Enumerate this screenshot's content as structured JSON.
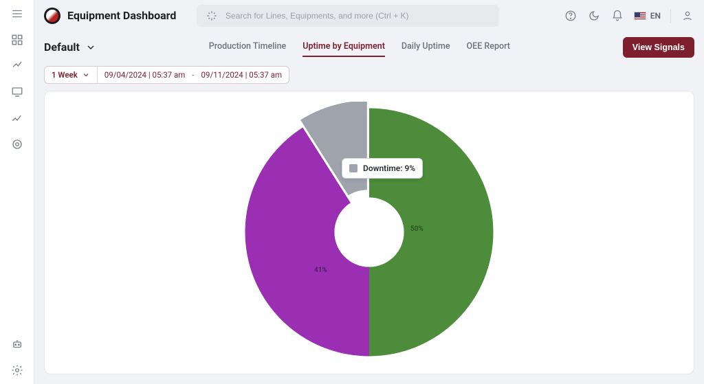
{
  "brand": {
    "title": "Equipment Dashboard"
  },
  "search": {
    "placeholder": "Search for Lines, Equipments, and more (Ctrl + K)"
  },
  "lang": {
    "code": "EN"
  },
  "viewSelector": {
    "label": "Default"
  },
  "tabs": [
    {
      "label": "Production Timeline",
      "active": false
    },
    {
      "label": "Uptime by Equipment",
      "active": true
    },
    {
      "label": "Daily Uptime",
      "active": false
    },
    {
      "label": "OEE Report",
      "active": false
    }
  ],
  "actions": {
    "viewSignals": "View Signals"
  },
  "filters": {
    "period": "1 Week",
    "from": "09/04/2024 | 05:37 am",
    "to": "09/11/2024 | 05:37 am",
    "separator": "-"
  },
  "tooltip": {
    "label": "Downtime: 9%"
  },
  "chart_data": {
    "type": "pie",
    "title": "",
    "series": [
      {
        "name": "Uptime (green)",
        "value": 50,
        "color": "#4c8c3a"
      },
      {
        "name": "Uptime (purple)",
        "value": 41,
        "color": "#9b2fb3"
      },
      {
        "name": "Downtime",
        "value": 9,
        "color": "#9ea3ac"
      }
    ],
    "inner_radius_ratio": 0.28,
    "legend": false
  },
  "slice_labels": {
    "green": "50%",
    "purple": "41%"
  }
}
